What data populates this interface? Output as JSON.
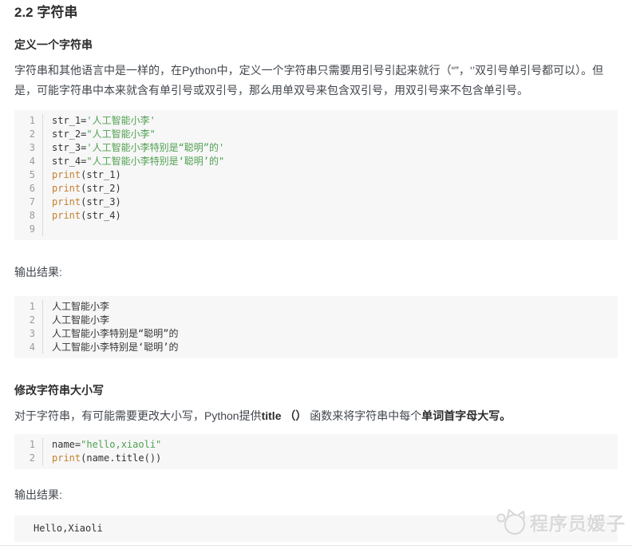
{
  "page": {
    "title": "2.2 字符串",
    "watermark_text": "程序员媛子"
  },
  "colors": {
    "code_string": "#50a14f",
    "code_keyword": "#c4802e",
    "code_plain": "#333333",
    "line_number": "#9a9a9a",
    "code_background": "#f7f7f8"
  },
  "section_define": {
    "heading": "定义一个字符串",
    "paragraph": "字符串和其他语言中是一样的，在Python中，定义一个字符串只需要用引号引起来就行（“”，‘’双引号单引号都可以）。但是，可能字符串中本来就含有单引号或双引号，那么用单双号来包含双引号，用双引号来不包含单引号。",
    "code_lines": [
      [
        {
          "c": "p",
          "v": "str_1="
        },
        {
          "c": "s",
          "v": "'人工智能小李'"
        }
      ],
      [
        {
          "c": "p",
          "v": "str_2="
        },
        {
          "c": "s",
          "v": "\"人工智能小李\""
        }
      ],
      [
        {
          "c": "p",
          "v": "str_3="
        },
        {
          "c": "s",
          "v": "'人工智能小李特别是“聪明”的'"
        }
      ],
      [
        {
          "c": "p",
          "v": "str_4="
        },
        {
          "c": "s",
          "v": "\"人工智能小李特别是‘聪明’的\""
        }
      ],
      [
        {
          "c": "k",
          "v": "print"
        },
        {
          "c": "p",
          "v": "(str_1)"
        }
      ],
      [
        {
          "c": "k",
          "v": "print"
        },
        {
          "c": "p",
          "v": "(str_2)"
        }
      ],
      [
        {
          "c": "k",
          "v": "print"
        },
        {
          "c": "p",
          "v": "(str_3)"
        }
      ],
      [
        {
          "c": "k",
          "v": "print"
        },
        {
          "c": "p",
          "v": "(str_4)"
        }
      ],
      []
    ],
    "output_label": "输出结果:",
    "output_lines": [
      "人工智能小李",
      "人工智能小李",
      "人工智能小李特别是“聪明”的",
      "人工智能小李特别是‘聪明’的"
    ]
  },
  "section_title_case": {
    "heading": "修改字符串大小写",
    "paragraph_segments": [
      {
        "bold": false,
        "text": "对于字符串，有可能需要更改大小写，Python提供"
      },
      {
        "bold": true,
        "text": "title （） "
      },
      {
        "bold": false,
        "text": "函数来将字符串中每个"
      },
      {
        "bold": true,
        "text": "单词首字母大写。"
      }
    ],
    "code_lines": [
      [
        {
          "c": "p",
          "v": "name="
        },
        {
          "c": "s",
          "v": "\"hello,xiaoli\""
        }
      ],
      [
        {
          "c": "k",
          "v": "print"
        },
        {
          "c": "p",
          "v": "(name.title())"
        }
      ]
    ],
    "output_label": "输出结果:",
    "output_lines": [
      "Hello,Xiaoli"
    ]
  }
}
